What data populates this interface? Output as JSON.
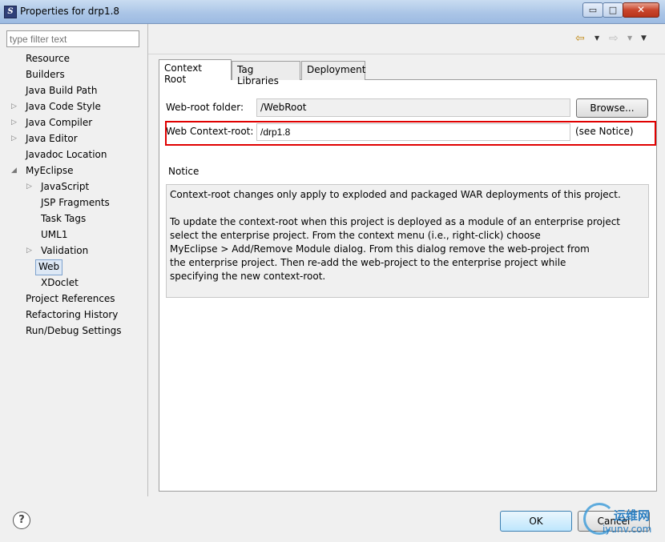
{
  "window": {
    "title": "Properties for drp1.8",
    "controls": {
      "minimize": "▭",
      "maximize": "□",
      "close": "✕"
    }
  },
  "filter": {
    "placeholder": "type filter text"
  },
  "tree": {
    "items": [
      {
        "label": "Resource",
        "expandable": false
      },
      {
        "label": "Builders",
        "expandable": false
      },
      {
        "label": "Java Build Path",
        "expandable": false
      },
      {
        "label": "Java Code Style",
        "expandable": true
      },
      {
        "label": "Java Compiler",
        "expandable": true
      },
      {
        "label": "Java Editor",
        "expandable": true
      },
      {
        "label": "Javadoc Location",
        "expandable": false
      },
      {
        "label": "MyEclipse",
        "expandable": true,
        "expanded": true
      },
      {
        "label": "JavaScript",
        "expandable": true
      },
      {
        "label": "JSP Fragments",
        "expandable": false
      },
      {
        "label": "Task Tags",
        "expandable": false
      },
      {
        "label": "UML1",
        "expandable": false
      },
      {
        "label": "Validation",
        "expandable": true
      },
      {
        "label": "Web",
        "expandable": false,
        "selected": true
      },
      {
        "label": "XDoclet",
        "expandable": false
      },
      {
        "label": "Project References",
        "expandable": false
      },
      {
        "label": "Refactoring History",
        "expandable": false
      },
      {
        "label": "Run/Debug Settings",
        "expandable": false
      }
    ]
  },
  "nav": {
    "back_icon": "⇦",
    "forward_icon": "⇨",
    "dropdown": "▼"
  },
  "tabs": [
    {
      "label": "Context Root",
      "active": true
    },
    {
      "label": "Tag Libraries",
      "active": false
    },
    {
      "label": "Deployment",
      "active": false
    }
  ],
  "context_root": {
    "webroot_label": "Web-root folder:",
    "webroot_value": "/WebRoot",
    "browse_label": "Browse...",
    "ctx_label": "Web Context-root:",
    "ctx_value": "/drp1.8",
    "see_notice": "(see Notice)",
    "notice_title": "Notice",
    "notice_text": "Context-root changes only apply to exploded and packaged WAR deployments of this project.\n\nTo update the context-root when this project is deployed as a module of an enterprise project\nselect the enterprise project. From the context menu (i.e., right-click) choose\nMyEclipse > Add/Remove Module dialog. From this dialog remove the web-project from\nthe enterprise project. Then re-add the web-project to the enterprise project while\nspecifying the new context-root."
  },
  "footer": {
    "help_icon": "?",
    "ok_label": "OK",
    "cancel_label": "Cancel"
  },
  "watermark": {
    "cn": "运维网",
    "url": "iyunv.com"
  },
  "colors": {
    "highlight": "#e00000",
    "selection": "#dde8f5"
  }
}
